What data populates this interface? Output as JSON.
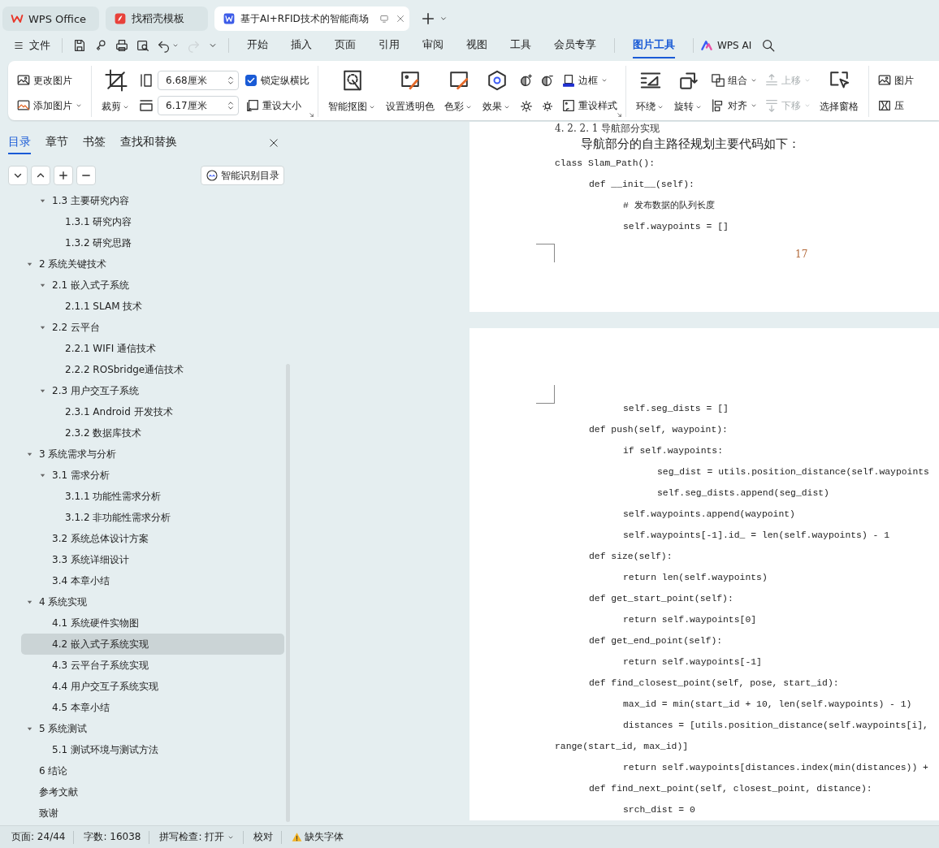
{
  "title_tabs": [
    {
      "kind": "home",
      "label": "WPS Office",
      "selected": false
    },
    {
      "kind": "template",
      "label": "找稻壳模板",
      "selected": false
    },
    {
      "kind": "document",
      "label": "基于AI+RFID技术的智能商场",
      "selected": true
    }
  ],
  "menu": {
    "file": "文件",
    "quick_access": [
      {
        "disabled": false,
        "dropdown": false
      },
      {
        "disabled": false,
        "dropdown": false
      },
      {
        "disabled": false,
        "dropdown": false
      },
      {
        "disabled": false,
        "dropdown": false
      },
      {
        "disabled": false,
        "dropdown": true
      },
      {
        "disabled": true,
        "dropdown": false
      },
      {
        "disabled": false,
        "dropdown": false
      }
    ],
    "tabs": [
      {
        "kind": "main",
        "label": "开始",
        "selected": false
      },
      {
        "kind": "main",
        "label": "插入",
        "selected": false
      },
      {
        "kind": "main",
        "label": "页面",
        "selected": false
      },
      {
        "kind": "main",
        "label": "引用",
        "selected": false
      },
      {
        "kind": "main",
        "label": "审阅",
        "selected": false
      },
      {
        "kind": "main",
        "label": "视图",
        "selected": false
      },
      {
        "kind": "main",
        "label": "工具",
        "selected": false
      },
      {
        "kind": "main",
        "label": "会员专享",
        "selected": false
      },
      {
        "kind": "context",
        "label": "图片工具",
        "selected": true
      }
    ],
    "ai": "WPS AI"
  },
  "ribbon": [
    {
      "launcher": false,
      "columns": [
        {
          "kind": "stack",
          "items": [
            {
              "kind": "button",
              "label": "更改图片",
              "dropdown": false,
              "disabled": false
            },
            {
              "kind": "button",
              "label": "添加图片",
              "dropdown": true,
              "disabled": false
            }
          ]
        }
      ]
    },
    {
      "launcher": true,
      "columns": [
        {
          "kind": "large",
          "label": "裁剪",
          "dropdown": true,
          "disabled": false
        },
        {
          "kind": "stack",
          "items": [
            {
              "kind": "spin",
              "value": "6.68厘米"
            },
            {
              "kind": "spin",
              "value": "6.17厘米"
            }
          ]
        },
        {
          "kind": "stack",
          "items": [
            {
              "kind": "checkbox",
              "label": "锁定纵横比",
              "checked": true
            },
            {
              "kind": "button",
              "label": "重设大小",
              "dropdown": false,
              "disabled": false
            }
          ]
        }
      ]
    },
    {
      "launcher": true,
      "columns": [
        {
          "kind": "large",
          "label": "智能抠图",
          "dropdown": true,
          "disabled": false
        },
        {
          "kind": "large",
          "label": "设置透明色",
          "dropdown": false,
          "disabled": false
        },
        {
          "kind": "large",
          "label": "色彩",
          "dropdown": true,
          "disabled": false
        },
        {
          "kind": "large",
          "label": "效果",
          "dropdown": true,
          "disabled": false
        },
        {
          "kind": "stack",
          "items": [
            {
              "kind": "icon",
              "disabled": false
            },
            {
              "kind": "icon",
              "disabled": false
            }
          ]
        },
        {
          "kind": "stack",
          "items": [
            {
              "kind": "icon",
              "disabled": false
            },
            {
              "kind": "icon",
              "disabled": false
            }
          ]
        },
        {
          "kind": "stack",
          "items": [
            {
              "kind": "button",
              "label": "边框",
              "dropdown": true,
              "disabled": false
            },
            {
              "kind": "button",
              "label": "重设样式",
              "dropdown": false,
              "disabled": false
            }
          ]
        }
      ]
    },
    {
      "launcher": false,
      "columns": [
        {
          "kind": "large",
          "label": "环绕",
          "dropdown": true,
          "disabled": false
        },
        {
          "kind": "large",
          "label": "旋转",
          "dropdown": true,
          "disabled": false
        },
        {
          "kind": "stack",
          "items": [
            {
              "kind": "button",
              "label": "组合",
              "dropdown": true,
              "disabled": false
            },
            {
              "kind": "button",
              "label": "对齐",
              "dropdown": true,
              "disabled": false
            }
          ]
        },
        {
          "kind": "stack",
          "items": [
            {
              "kind": "button",
              "label": "上移",
              "dropdown": true,
              "disabled": true
            },
            {
              "kind": "button",
              "label": "下移",
              "dropdown": true,
              "disabled": true
            }
          ]
        },
        {
          "kind": "large",
          "label": "选择窗格",
          "dropdown": false,
          "disabled": false
        }
      ]
    },
    {
      "launcher": false,
      "columns": [
        {
          "kind": "stack",
          "items": [
            {
              "kind": "button",
              "label": "图片",
              "dropdown": false,
              "disabled": false
            },
            {
              "kind": "button",
              "label": "压",
              "dropdown": false,
              "disabled": false
            }
          ]
        }
      ]
    }
  ],
  "sidebar": {
    "tabs": [
      {
        "label": "目录",
        "selected": true
      },
      {
        "label": "章节",
        "selected": false
      },
      {
        "label": "书签",
        "selected": false
      },
      {
        "label": "查找和替换",
        "selected": false
      }
    ],
    "smart_toc": "智能识别目录",
    "toc": {
      "continued": [
        {
          "label": "1.3 主要研究内容",
          "expanded": true,
          "selected": false,
          "children": [
            {
              "label": "1.3.1 研究内容",
              "selected": false
            },
            {
              "label": "1.3.2 研究思路",
              "selected": false
            }
          ]
        }
      ],
      "items": [
        {
          "label": "2  系统关键技术",
          "expanded": true,
          "selected": false,
          "children": [
            {
              "label": "2.1 嵌入式子系统",
              "expanded": true,
              "selected": false,
              "children": [
                {
                  "label": "2.1.1 SLAM 技术",
                  "selected": false
                }
              ]
            },
            {
              "label": "2.2 云平台",
              "expanded": true,
              "selected": false,
              "children": [
                {
                  "label": "2.2.1 WIFI 通信技术",
                  "selected": false
                },
                {
                  "label": "2.2.2 ROSbridge通信技术",
                  "selected": false
                }
              ]
            },
            {
              "label": "2.3 用户交互子系统",
              "expanded": true,
              "selected": false,
              "children": [
                {
                  "label": "2.3.1 Android 开发技术",
                  "selected": false
                },
                {
                  "label": "2.3.2  数据库技术",
                  "selected": false
                }
              ]
            }
          ]
        },
        {
          "label": "3 系统需求与分析",
          "expanded": true,
          "selected": false,
          "children": [
            {
              "label": "3.1 需求分析",
              "expanded": true,
              "selected": false,
              "children": [
                {
                  "label": "3.1.1  功能性需求分析",
                  "selected": false
                },
                {
                  "label": "3.1.2  非功能性需求分析",
                  "selected": false
                }
              ]
            },
            {
              "label": "3.2 系统总体设计方案",
              "selected": false
            },
            {
              "label": "3.3 系统详细设计",
              "selected": false
            },
            {
              "label": "3.4 本章小结",
              "selected": false
            }
          ]
        },
        {
          "label": "4  系统实现",
          "expanded": true,
          "selected": false,
          "children": [
            {
              "label": "4.1 系统硬件实物图",
              "selected": false
            },
            {
              "label": "4.2 嵌入式子系统实现",
              "selected": true
            },
            {
              "label": "4.3 云平台子系统实现",
              "selected": false
            },
            {
              "label": "4.4  用户交互子系统实现",
              "selected": false
            },
            {
              "label": "4.5  本章小结",
              "selected": false
            }
          ]
        },
        {
          "label": "5  系统测试",
          "expanded": true,
          "selected": false,
          "children": [
            {
              "label": "5.1  测试环境与测试方法",
              "selected": false
            }
          ]
        },
        {
          "label": "6  结论",
          "selected": false
        },
        {
          "label": "参考文献",
          "selected": false
        },
        {
          "label": "致谢",
          "selected": false
        }
      ]
    }
  },
  "document": {
    "pages": [
      {
        "heading": "4. 2. 2. 1  导航部分实现",
        "paragraph": "导航部分的自主路径规划主要代码如下：",
        "page_number": "17",
        "code": [
          "class Slam_Path():",
          "\tdef __init__(self):",
          "\t\t# 发布数据的队列长度",
          "\t\tself.waypoints = []"
        ]
      },
      {
        "code": [
          "\t\tself.seg_dists = []",
          "\tdef push(self, waypoint):",
          "\t\tif self.waypoints:",
          "\t\t\tseg_dist = utils.position_distance(self.waypoints",
          "\t\t\tself.seg_dists.append(seg_dist)",
          "\t\tself.waypoints.append(waypoint)",
          "\t\tself.waypoints[-1].id_ = len(self.waypoints) - 1",
          "\tdef size(self):",
          "\t\treturn len(self.waypoints)",
          "\tdef get_start_point(self):",
          "\t\treturn self.waypoints[0]",
          "\tdef get_end_point(self):",
          "\t\treturn self.waypoints[-1]",
          "\tdef find_closest_point(self, pose, start_id):",
          "\t\tmax_id = min(start_id + 10, len(self.waypoints) - 1)",
          "\t\tdistances = [utils.position_distance(self.waypoints[i],",
          "range(start_id, max_id)]",
          "\t\treturn self.waypoints[distances.index(min(distances)) +",
          "\tdef find_next_point(self, closest_point, distance):",
          "\t\tsrch_dist = 0"
        ]
      }
    ]
  },
  "status_bar": {
    "page": "页面: 24/44",
    "words": "字数: 16038",
    "spell": "拼写检查: 打开",
    "proof": "校对",
    "warning": "缺失字体"
  }
}
